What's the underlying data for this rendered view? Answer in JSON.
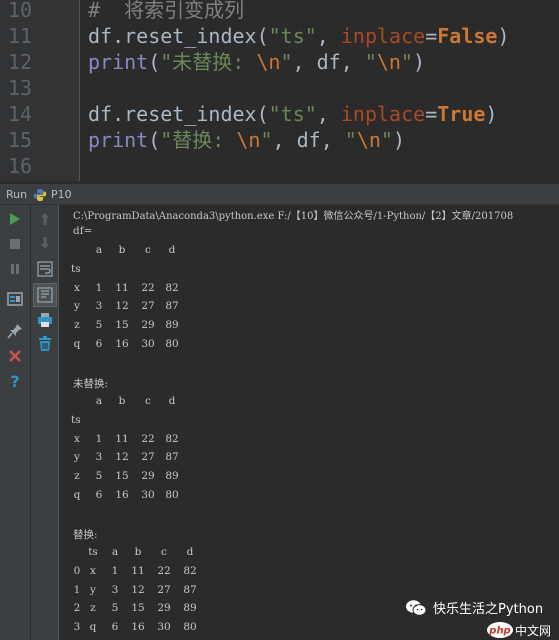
{
  "editor": {
    "line_numbers": [
      "10",
      "11",
      "12",
      "13",
      "14",
      "15",
      "16"
    ],
    "lines": [
      [
        {
          "t": "#  将索引变成列",
          "c": "cm"
        }
      ],
      [
        {
          "t": "df.reset_index(",
          "c": ""
        },
        {
          "t": "\"ts\"",
          "c": "st"
        },
        {
          "t": ", ",
          "c": ""
        },
        {
          "t": "inplace",
          "c": "kw"
        },
        {
          "t": "=",
          "c": ""
        },
        {
          "t": "False",
          "c": "bo"
        },
        {
          "t": ")",
          "c": ""
        }
      ],
      [
        {
          "t": "print",
          "c": "fn"
        },
        {
          "t": "(",
          "c": ""
        },
        {
          "t": "\"未替换: ",
          "c": "st"
        },
        {
          "t": "\\n",
          "c": "esc"
        },
        {
          "t": "\"",
          "c": "st"
        },
        {
          "t": ", df, ",
          "c": ""
        },
        {
          "t": "\"",
          "c": "st"
        },
        {
          "t": "\\n",
          "c": "esc"
        },
        {
          "t": "\"",
          "c": "st"
        },
        {
          "t": ")",
          "c": ""
        }
      ],
      [],
      [
        {
          "t": "df.reset_index(",
          "c": ""
        },
        {
          "t": "\"ts\"",
          "c": "st"
        },
        {
          "t": ", ",
          "c": ""
        },
        {
          "t": "inplace",
          "c": "kw"
        },
        {
          "t": "=",
          "c": ""
        },
        {
          "t": "True",
          "c": "bo"
        },
        {
          "t": ")",
          "c": ""
        }
      ],
      [
        {
          "t": "print",
          "c": "fn"
        },
        {
          "t": "(",
          "c": ""
        },
        {
          "t": "\"替换: ",
          "c": "st"
        },
        {
          "t": "\\n",
          "c": "esc"
        },
        {
          "t": "\"",
          "c": "st"
        },
        {
          "t": ", df, ",
          "c": ""
        },
        {
          "t": "\"",
          "c": "st"
        },
        {
          "t": "\\n",
          "c": "esc"
        },
        {
          "t": "\"",
          "c": "st"
        },
        {
          "t": ")",
          "c": ""
        }
      ],
      []
    ]
  },
  "run": {
    "label": "Run",
    "config": "P10",
    "icon": "python-icon"
  },
  "toolbar_left": [
    {
      "name": "run-icon",
      "color": "#499c54"
    },
    {
      "name": "stop-icon",
      "color": "#7a7a7a"
    },
    {
      "name": "pause-icon",
      "color": "#7a7a7a"
    },
    {
      "name": "dump-threads-icon",
      "color": "#9aa7b0"
    },
    {
      "name": "pin-icon",
      "color": "#9aa7b0"
    },
    {
      "name": "close-icon",
      "color": "#c75450"
    },
    {
      "name": "help-icon",
      "color": "#3592c4"
    }
  ],
  "toolbar_right": [
    {
      "name": "up-arrow-icon"
    },
    {
      "name": "down-arrow-icon"
    },
    {
      "name": "soft-wrap-icon"
    },
    {
      "name": "scroll-to-end-icon"
    },
    {
      "name": "print-icon"
    },
    {
      "name": "trash-icon"
    }
  ],
  "console": {
    "command": "C:\\ProgramData\\Anaconda3\\python.exe F:/【10】微信公众号/1-Python/【2】文章/201708",
    "df_label": "df=",
    "unreplaced_label": "未替换:",
    "replaced_label": "替换:",
    "table1": {
      "header": [
        "",
        "a",
        "b",
        "c",
        "d"
      ],
      "index_name": "ts",
      "rows": [
        [
          "x",
          "1",
          "11",
          "22",
          "82"
        ],
        [
          "y",
          "3",
          "12",
          "27",
          "87"
        ],
        [
          "z",
          "5",
          "15",
          "29",
          "89"
        ],
        [
          "q",
          "6",
          "16",
          "30",
          "80"
        ]
      ]
    },
    "table2": {
      "header": [
        "",
        "a",
        "b",
        "c",
        "d"
      ],
      "index_name": "ts",
      "rows": [
        [
          "x",
          "1",
          "11",
          "22",
          "82"
        ],
        [
          "y",
          "3",
          "12",
          "27",
          "87"
        ],
        [
          "z",
          "5",
          "15",
          "29",
          "89"
        ],
        [
          "q",
          "6",
          "16",
          "30",
          "80"
        ]
      ]
    },
    "table3": {
      "header": [
        "",
        "ts",
        "a",
        "b",
        "c",
        "d"
      ],
      "rows": [
        [
          "0",
          "x",
          "1",
          "11",
          "22",
          "82"
        ],
        [
          "1",
          "y",
          "3",
          "12",
          "27",
          "87"
        ],
        [
          "2",
          "z",
          "5",
          "15",
          "29",
          "89"
        ],
        [
          "3",
          "q",
          "6",
          "16",
          "30",
          "80"
        ]
      ]
    }
  },
  "watermark": {
    "text": "快乐生活之Python",
    "logo_text": "php",
    "logo_suffix": "中文网"
  }
}
